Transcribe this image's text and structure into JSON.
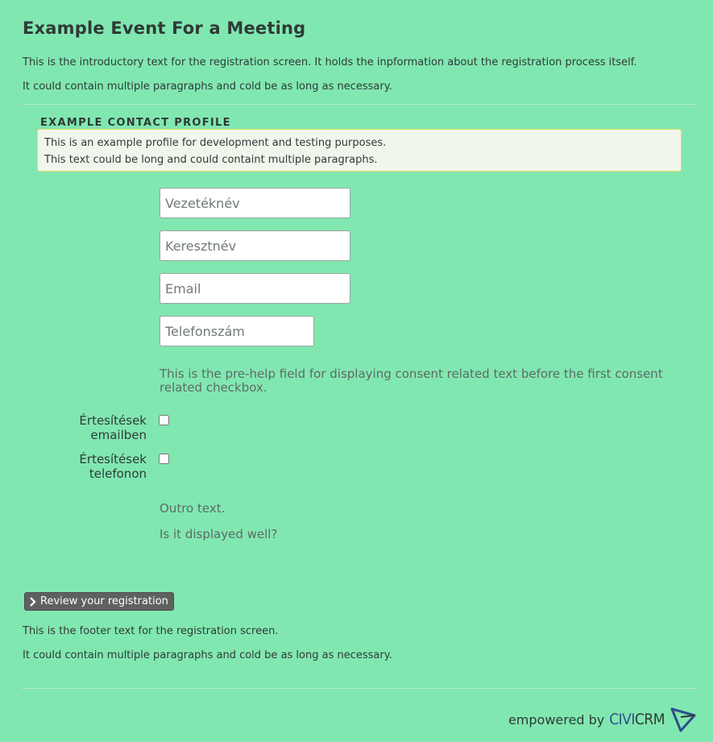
{
  "event": {
    "title": "Example Event For a Meeting",
    "intro": [
      "This is the introductory text for the registration screen. It holds the inpformation about the registration process itself.",
      "It could contain multiple paragraphs and cold be as long as necessary."
    ]
  },
  "profile": {
    "title": "EXAMPLE CONTACT PROFILE",
    "help": [
      "This is an example profile for development and testing purposes.",
      "This text could be long and could containt multiple paragraphs."
    ],
    "fields": {
      "last_name_placeholder": "Vezetéknév",
      "first_name_placeholder": "Keresztnév",
      "email_placeholder": "Email",
      "phone_placeholder": "Telefonszám"
    },
    "prehelp": "This is the pre-help field for displaying consent related text before the first consent related checkbox.",
    "consents": [
      {
        "label": "Értesítések emailben",
        "checked": false
      },
      {
        "label": "Értesítések telefonon",
        "checked": false
      }
    ],
    "outro": [
      "Outro text.",
      "Is it displayed well?"
    ]
  },
  "actions": {
    "review_label": "Review your registration"
  },
  "footer": {
    "text": [
      "This is the footer text for the registration screen.",
      "It could contain multiple paragraphs and cold be as long as necessary."
    ],
    "powered_by": "empowered by",
    "brand_civi": "CIVI",
    "brand_crm": "CRM"
  },
  "colors": {
    "background": "#81e7b1",
    "help_box_bg": "#f0f6ec",
    "help_box_border": "#e0e05a",
    "button_bg": "#5f6160",
    "brand_blue": "#2b4f8a"
  }
}
